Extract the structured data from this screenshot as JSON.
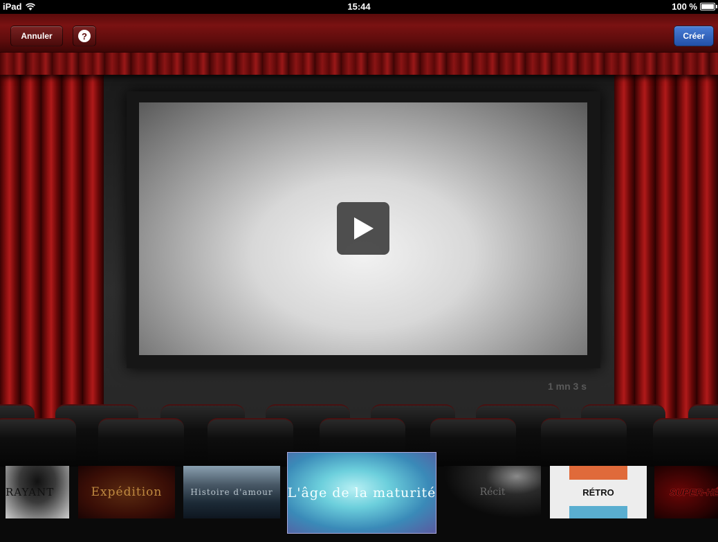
{
  "status_bar": {
    "device": "iPad",
    "time": "15:44",
    "battery": "100 %",
    "icons": [
      "wifi-icon",
      "battery-icon"
    ]
  },
  "toolbar": {
    "cancel_label": "Annuler",
    "help_label": "?",
    "create_label": "Créer"
  },
  "preview": {
    "duration": "1 mn 3 s",
    "play_icon": "play-icon"
  },
  "themes": [
    {
      "label": "RAYANT",
      "selected": false
    },
    {
      "label": "Expédition",
      "selected": false
    },
    {
      "label": "Histoire d'amour",
      "selected": false
    },
    {
      "label": "L'âge de la maturité",
      "selected": true
    },
    {
      "label": "Récit",
      "selected": false
    },
    {
      "label": "RÉTRO",
      "selected": false
    },
    {
      "label": "SUPER-HÉ",
      "selected": false
    }
  ],
  "colors": {
    "toolbar": "#6a0f0f",
    "create_button": "#2f62c0",
    "curtain": "#8c1010"
  }
}
